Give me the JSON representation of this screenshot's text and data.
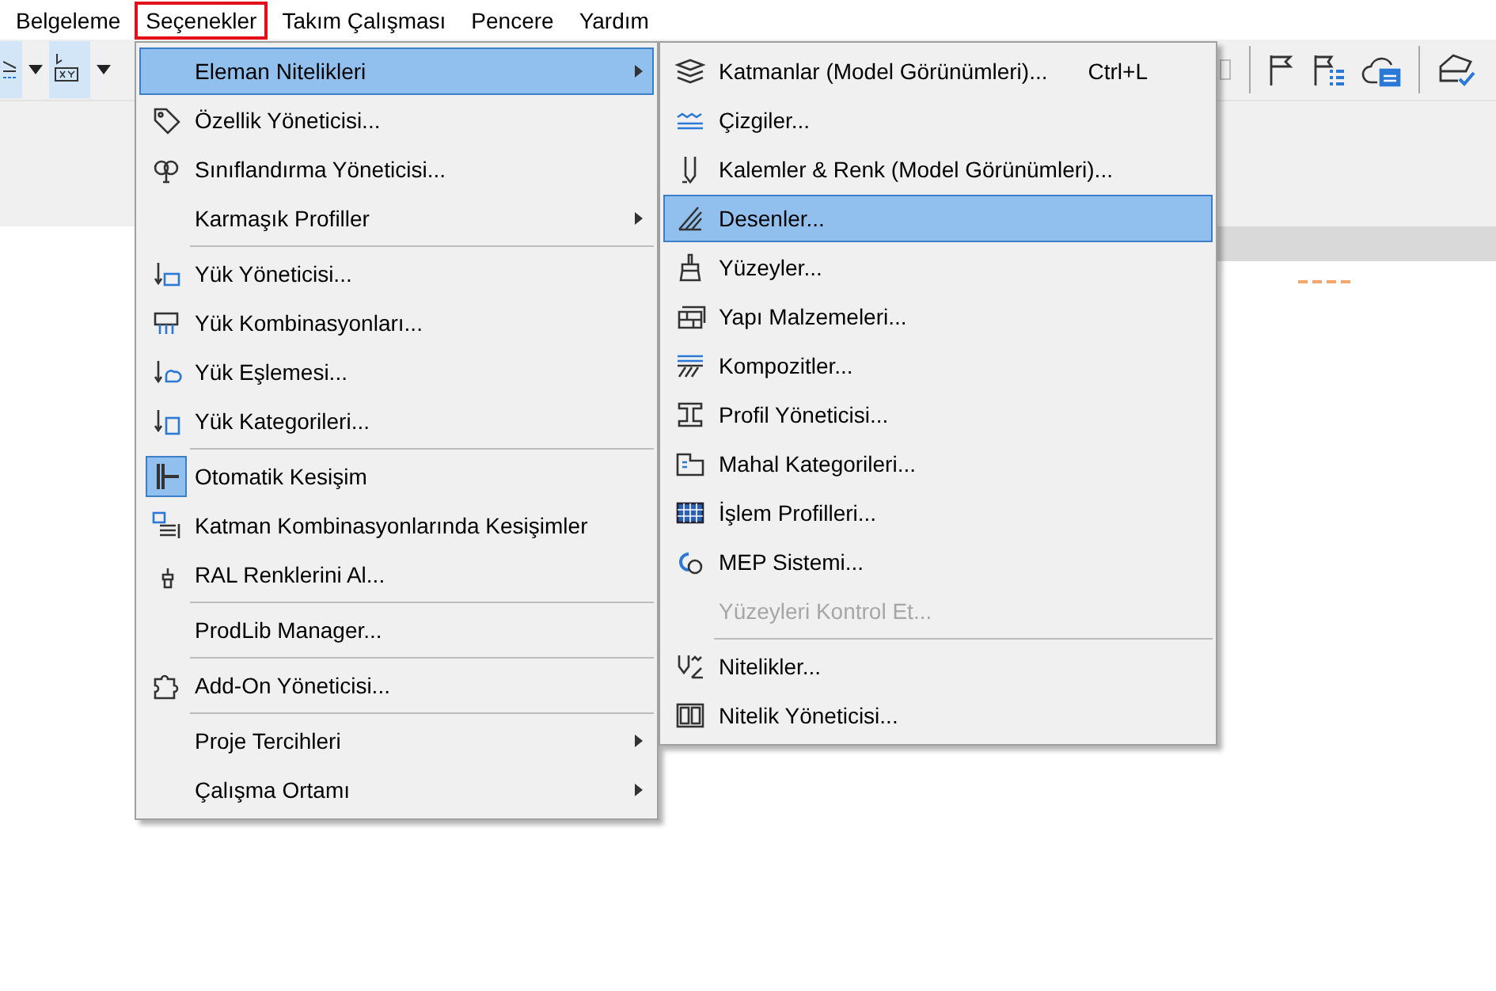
{
  "menu_bar": [
    {
      "label": "Belgeleme",
      "selected": false
    },
    {
      "label": "Seçenekler",
      "selected": true
    },
    {
      "label": "Takım Çalışması",
      "selected": false
    },
    {
      "label": "Pencere",
      "selected": false
    },
    {
      "label": "Yardım",
      "selected": false
    }
  ],
  "menu": {
    "items": [
      {
        "kind": "item",
        "label": "Eleman Nitelikleri",
        "selected": true,
        "submenu": true,
        "checked": false
      },
      {
        "kind": "item",
        "label": "Özellik Yöneticisi...",
        "selected": false,
        "submenu": false,
        "checked": false
      },
      {
        "kind": "item",
        "label": "Sınıflandırma Yöneticisi...",
        "selected": false,
        "submenu": false,
        "checked": false
      },
      {
        "kind": "item",
        "label": "Karmaşık Profiller",
        "selected": false,
        "submenu": true,
        "checked": false
      },
      {
        "kind": "separator"
      },
      {
        "kind": "item",
        "label": "Yük Yöneticisi...",
        "selected": false,
        "submenu": false,
        "checked": false
      },
      {
        "kind": "item",
        "label": "Yük Kombinasyonları...",
        "selected": false,
        "submenu": false,
        "checked": false
      },
      {
        "kind": "item",
        "label": "Yük Eşlemesi...",
        "selected": false,
        "submenu": false,
        "checked": false
      },
      {
        "kind": "item",
        "label": "Yük Kategorileri...",
        "selected": false,
        "submenu": false,
        "checked": false
      },
      {
        "kind": "separator"
      },
      {
        "kind": "item",
        "label": "Otomatik Kesişim",
        "selected": false,
        "submenu": false,
        "checked": true
      },
      {
        "kind": "item",
        "label": "Katman Kombinasyonlarında Kesişimler",
        "selected": false,
        "submenu": false,
        "checked": false
      },
      {
        "kind": "item",
        "label": "RAL Renklerini Al...",
        "selected": false,
        "submenu": false,
        "checked": false
      },
      {
        "kind": "separator"
      },
      {
        "kind": "item",
        "label": "ProdLib Manager...",
        "selected": false,
        "submenu": false,
        "checked": false
      },
      {
        "kind": "separator"
      },
      {
        "kind": "item",
        "label": "Add-On Yöneticisi...",
        "selected": false,
        "submenu": false,
        "checked": false
      },
      {
        "kind": "separator"
      },
      {
        "kind": "item",
        "label": "Proje Tercihleri",
        "selected": false,
        "submenu": true,
        "checked": false
      },
      {
        "kind": "item",
        "label": "Çalışma Ortamı",
        "selected": false,
        "submenu": true,
        "checked": false
      }
    ]
  },
  "submenu": {
    "items": [
      {
        "kind": "item",
        "label": "Katmanlar (Model Görünümleri)...",
        "shortcut": "Ctrl+L",
        "selected": false,
        "disabled": false
      },
      {
        "kind": "item",
        "label": "Çizgiler...",
        "selected": false,
        "disabled": false
      },
      {
        "kind": "item",
        "label": "Kalemler & Renk (Model Görünümleri)...",
        "selected": false,
        "disabled": false
      },
      {
        "kind": "item",
        "label": "Desenler...",
        "selected": true,
        "disabled": false
      },
      {
        "kind": "item",
        "label": "Yüzeyler...",
        "selected": false,
        "disabled": false
      },
      {
        "kind": "item",
        "label": "Yapı Malzemeleri...",
        "selected": false,
        "disabled": false
      },
      {
        "kind": "item",
        "label": "Kompozitler...",
        "selected": false,
        "disabled": false
      },
      {
        "kind": "item",
        "label": "Profil Yöneticisi...",
        "selected": false,
        "disabled": false
      },
      {
        "kind": "item",
        "label": "Mahal Kategorileri...",
        "selected": false,
        "disabled": false
      },
      {
        "kind": "item",
        "label": "İşlem Profilleri...",
        "selected": false,
        "disabled": false
      },
      {
        "kind": "item",
        "label": "MEP Sistemi...",
        "selected": false,
        "disabled": false
      },
      {
        "kind": "item",
        "label": "Yüzeyleri Kontrol Et...",
        "selected": false,
        "disabled": true
      },
      {
        "kind": "separator"
      },
      {
        "kind": "item",
        "label": "Nitelikler...",
        "selected": false,
        "disabled": false
      },
      {
        "kind": "item",
        "label": "Nitelik Yöneticisi...",
        "selected": false,
        "disabled": false
      }
    ]
  }
}
